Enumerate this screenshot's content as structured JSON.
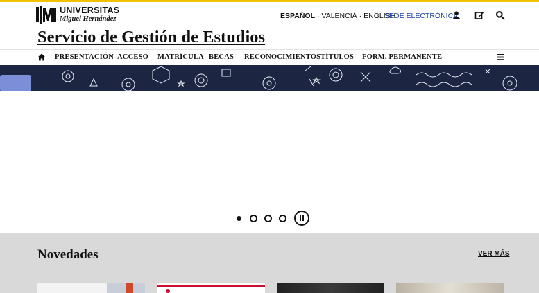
{
  "brand": {
    "line1": "UNIVERSITAS",
    "line2": "Miguel Hernández"
  },
  "languages": [
    {
      "label": "ESPAÑOL",
      "active": true
    },
    {
      "label": "VALENCIÀ",
      "active": false
    },
    {
      "label": "ENGLISH",
      "active": false
    }
  ],
  "header": {
    "sede_label": "SEDE ELECTRÓNICA",
    "site_title": "Servicio de Gestión de Estudios",
    "icons": [
      "user-icon",
      "edit-icon",
      "search-icon"
    ]
  },
  "nav": {
    "items": [
      {
        "label": "PRESENTACIÓN"
      },
      {
        "label": "ACCESO"
      },
      {
        "label": "MATRÍCULA"
      },
      {
        "label": "BECAS"
      },
      {
        "label": "RECONOCIMIENTOS"
      },
      {
        "label": "TÍTULOS"
      },
      {
        "label": "FORM. PERMANENTE"
      }
    ]
  },
  "carousel": {
    "slide_count": 4,
    "active_slide": 1,
    "state": "playing"
  },
  "news": {
    "title": "Novedades",
    "see_more": "VER MÁS",
    "cards": 4
  },
  "colors": {
    "accent_bar": "#f2c200",
    "banner_bg": "#1c2541",
    "link_blue": "#1a3fa8",
    "news_bg": "#d9d9d9"
  }
}
